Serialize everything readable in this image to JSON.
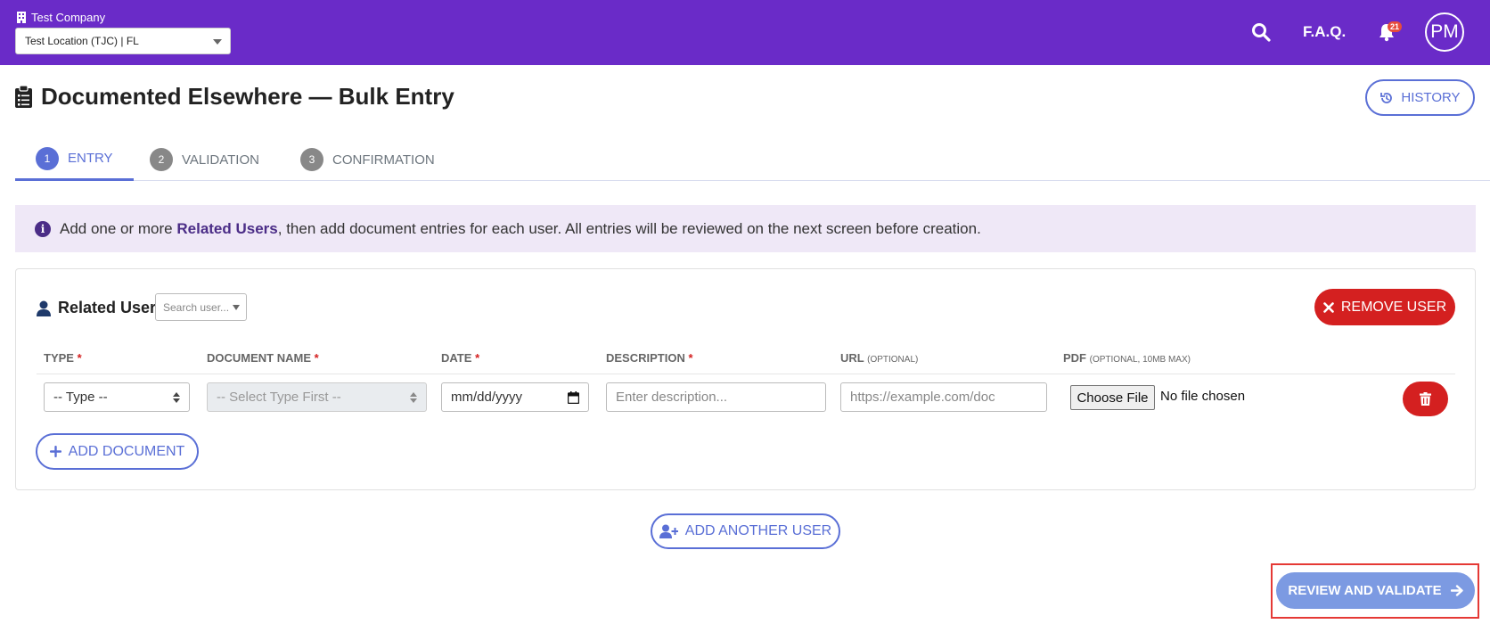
{
  "topbar": {
    "company": "Test Company",
    "location": "Test Location (TJC) | FL",
    "faq_label": "F.A.Q.",
    "notifications_count": "21",
    "avatar_initials": "PM",
    "brand_color": "#6a2bc8",
    "icons": {
      "company": "building-icon",
      "search": "search-icon",
      "notifications": "bell-icon"
    }
  },
  "page": {
    "title": "Documented Elsewhere — Bulk Entry",
    "title_icon": "clipboard-list-icon",
    "history_label": "HISTORY",
    "history_icon": "history-icon"
  },
  "steps": [
    {
      "num": "1",
      "label": "ENTRY",
      "active": true
    },
    {
      "num": "2",
      "label": "VALIDATION",
      "active": false
    },
    {
      "num": "3",
      "label": "CONFIRMATION",
      "active": false
    }
  ],
  "alert": {
    "prefix": "Add one or more ",
    "bold": "Related Users",
    "suffix": ", then add document entries for each user. All entries will be reviewed on the next screen before creation."
  },
  "user_card": {
    "related_user_label": "Related User:",
    "search_placeholder": "Search user...",
    "remove_user_label": "REMOVE USER",
    "columns": {
      "type": "TYPE",
      "document_name": "DOCUMENT NAME",
      "date": "DATE",
      "description": "DESCRIPTION",
      "url": "URL",
      "url_note": "(OPTIONAL)",
      "pdf": "PDF",
      "pdf_note": "(OPTIONAL, 10MB MAX)",
      "required_mark": "*"
    },
    "row": {
      "type_value": "-- Type --",
      "document_name_value": "-- Select Type First --",
      "date_value": "mm/dd/yyyy",
      "description_placeholder": "Enter description...",
      "url_placeholder": "https://example.com/doc",
      "choose_file_label": "Choose File",
      "no_file_text": "No file chosen"
    },
    "add_document_label": "ADD DOCUMENT"
  },
  "add_another_user_label": "ADD ANOTHER USER",
  "review_label": "REVIEW AND VALIDATE",
  "colors": {
    "primary": "#5a6fd6",
    "danger": "#d42020",
    "review_button": "#7c9ae2",
    "highlight_outline": "#e53935"
  }
}
